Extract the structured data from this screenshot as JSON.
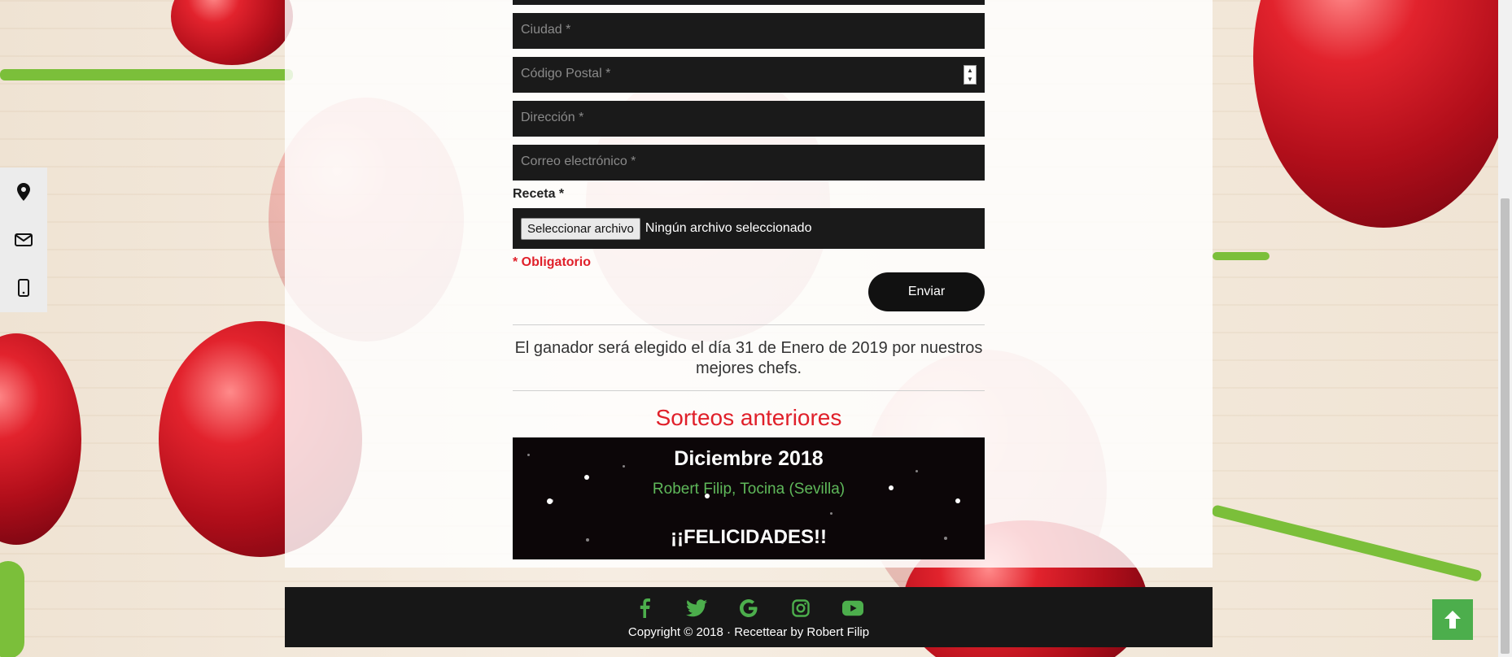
{
  "form": {
    "city_placeholder": "Ciudad *",
    "postal_placeholder": "Código Postal *",
    "address_placeholder": "Dirección *",
    "email_placeholder": "Correo electrónico *",
    "recipe_label": "Receta *",
    "file_button_label": "Seleccionar archivo",
    "file_status": "Ningún archivo seleccionado",
    "required_note": "* Obligatorio",
    "submit_label": "Enviar"
  },
  "announcement": "El ganador será elegido el día 31 de Enero de 2019 por nuestros mejores chefs.",
  "previous_draws": {
    "title": "Sorteos anteriores",
    "month": "Diciembre 2018",
    "winner": "Robert Filip, Tocina (Sevilla)",
    "congrats": "¡¡FELICIDADES!!"
  },
  "sidebar": {
    "icons": [
      "location-icon",
      "envelope-icon",
      "mobile-icon"
    ]
  },
  "footer": {
    "socials": [
      "facebook-icon",
      "twitter-icon",
      "google-icon",
      "instagram-icon",
      "youtube-icon"
    ],
    "copyright": "Copyright © 2018 · Recettear by Robert Filip"
  },
  "colors": {
    "accent_red": "#e0202a",
    "accent_green": "#4cae4c",
    "field_bg": "#1a1a1a"
  }
}
